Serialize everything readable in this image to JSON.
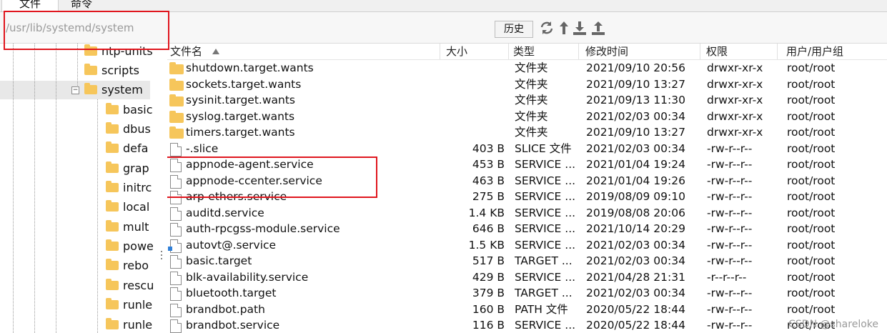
{
  "tabs": [
    "文件",
    "命令"
  ],
  "path": {
    "value": "/usr/lib/systemd/system"
  },
  "toolbar": {
    "history_label": "历史"
  },
  "tree": {
    "items": [
      {
        "label": "ntp-units"
      },
      {
        "label": "scripts"
      },
      {
        "label": "system"
      },
      {
        "label": "basic"
      },
      {
        "label": "dbus"
      },
      {
        "label": "defa"
      },
      {
        "label": "grap"
      },
      {
        "label": "initrc"
      },
      {
        "label": "local"
      },
      {
        "label": "mult"
      },
      {
        "label": "powe"
      },
      {
        "label": "rebo"
      },
      {
        "label": "rescu"
      },
      {
        "label": "runle"
      },
      {
        "label": "runle"
      }
    ]
  },
  "columns": {
    "name": "文件名",
    "size": "大小",
    "type": "类型",
    "modified": "修改时间",
    "permissions": "权限",
    "owner": "用户/用户组"
  },
  "files": [
    {
      "name": "shutdown.target.wants",
      "size": "",
      "type": "文件夹",
      "modified": "2021/09/10 20:56",
      "perm": "drwxr-xr-x",
      "owner": "root/root",
      "icon": "folder"
    },
    {
      "name": "sockets.target.wants",
      "size": "",
      "type": "文件夹",
      "modified": "2021/09/10 13:27",
      "perm": "drwxr-xr-x",
      "owner": "root/root",
      "icon": "folder"
    },
    {
      "name": "sysinit.target.wants",
      "size": "",
      "type": "文件夹",
      "modified": "2021/09/13 11:30",
      "perm": "drwxr-xr-x",
      "owner": "root/root",
      "icon": "folder"
    },
    {
      "name": "syslog.target.wants",
      "size": "",
      "type": "文件夹",
      "modified": "2021/02/03 00:34",
      "perm": "drwxr-xr-x",
      "owner": "root/root",
      "icon": "folder"
    },
    {
      "name": "timers.target.wants",
      "size": "",
      "type": "文件夹",
      "modified": "2021/09/10 13:27",
      "perm": "drwxr-xr-x",
      "owner": "root/root",
      "icon": "folder"
    },
    {
      "name": "-.slice",
      "size": "403 B",
      "type": "SLICE 文件",
      "modified": "2021/02/03 00:34",
      "perm": "-rw-r--r--",
      "owner": "root/root",
      "icon": "file"
    },
    {
      "name": "appnode-agent.service",
      "size": "453 B",
      "type": "SERVICE ...",
      "modified": "2021/01/04 19:24",
      "perm": "-rw-r--r--",
      "owner": "root/root",
      "icon": "file"
    },
    {
      "name": "appnode-ccenter.service",
      "size": "463 B",
      "type": "SERVICE ...",
      "modified": "2021/01/04 19:26",
      "perm": "-rw-r--r--",
      "owner": "root/root",
      "icon": "file"
    },
    {
      "name": "arp-ethers.service",
      "size": "275 B",
      "type": "SERVICE ...",
      "modified": "2019/08/09 09:10",
      "perm": "-rw-r--r--",
      "owner": "root/root",
      "icon": "file"
    },
    {
      "name": "auditd.service",
      "size": "1.4 KB",
      "type": "SERVICE ...",
      "modified": "2019/08/08 20:06",
      "perm": "-rw-r--r--",
      "owner": "root/root",
      "icon": "file"
    },
    {
      "name": "auth-rpcgss-module.service",
      "size": "646 B",
      "type": "SERVICE ...",
      "modified": "2021/10/14 20:29",
      "perm": "-rw-r--r--",
      "owner": "root/root",
      "icon": "file"
    },
    {
      "name": "autovt@.service",
      "size": "1.5 KB",
      "type": "SERVICE ...",
      "modified": "2021/02/03 00:34",
      "perm": "-rw-r--r--",
      "owner": "root/root",
      "icon": "link"
    },
    {
      "name": "basic.target",
      "size": "517 B",
      "type": "TARGET ...",
      "modified": "2021/02/03 00:34",
      "perm": "-rw-r--r--",
      "owner": "root/root",
      "icon": "file"
    },
    {
      "name": "blk-availability.service",
      "size": "429 B",
      "type": "SERVICE ...",
      "modified": "2021/04/28 21:31",
      "perm": "-r--r--r--",
      "owner": "root/root",
      "icon": "file"
    },
    {
      "name": "bluetooth.target",
      "size": "379 B",
      "type": "TARGET ...",
      "modified": "2021/02/03 00:34",
      "perm": "-rw-r--r--",
      "owner": "root/root",
      "icon": "file"
    },
    {
      "name": "brandbot.path",
      "size": "160 B",
      "type": "PATH 文件",
      "modified": "2020/05/22 18:44",
      "perm": "-rw-r--r--",
      "owner": "root/root",
      "icon": "file"
    },
    {
      "name": "brandbot.service",
      "size": "116 B",
      "type": "SERVICE ...",
      "modified": "2020/05/22 18:44",
      "perm": "-rw-r--r--",
      "owner": "root/root",
      "icon": "file"
    }
  ],
  "watermark": "CSDN @shareloke",
  "colors": {
    "highlight_box": "#e0161e",
    "folder": "#f6c65b"
  }
}
